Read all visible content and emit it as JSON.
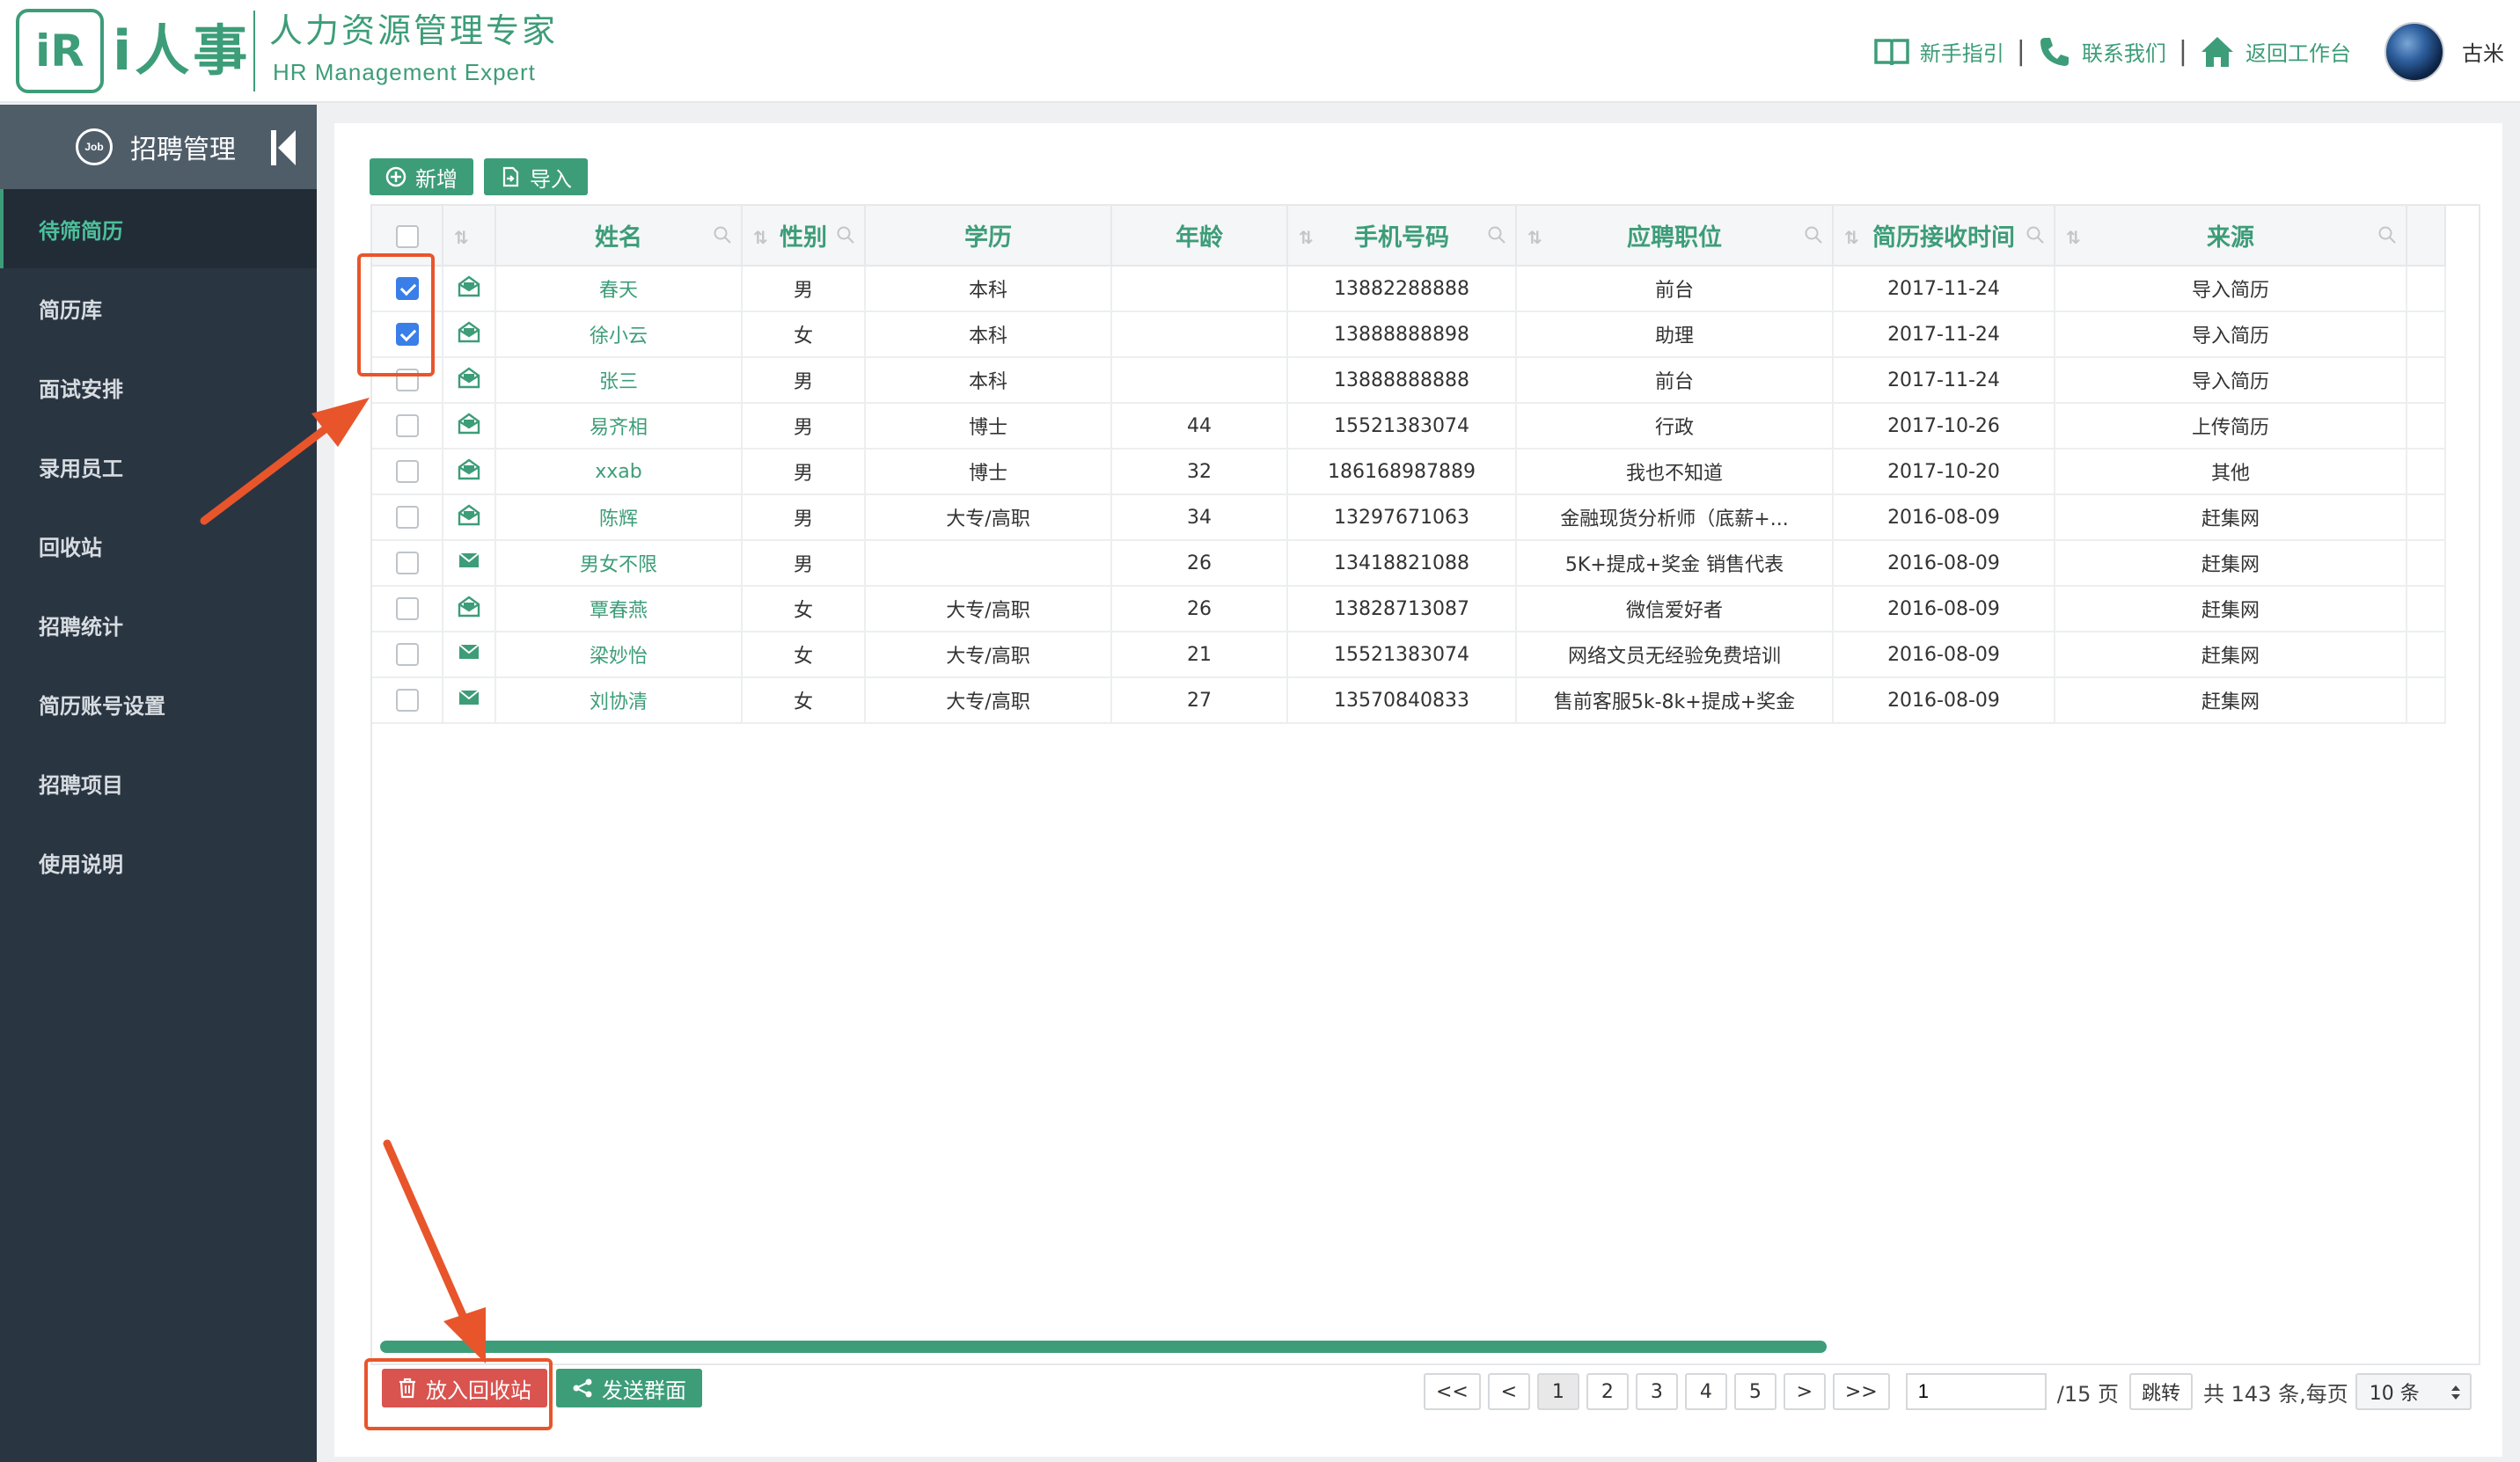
{
  "header": {
    "logo_mark": "iR",
    "logo_word": "i人事",
    "logo_cn": "人力资源管理专家",
    "logo_en": "HR Management Expert",
    "links": [
      "新手指引",
      "联系我们",
      "返回工作台"
    ],
    "username": "古米"
  },
  "sidebar": {
    "title": "招聘管理",
    "job_icon_text": "Job",
    "items": [
      "待筛简历",
      "简历库",
      "面试安排",
      "录用员工",
      "回收站",
      "招聘统计",
      "简历账号设置",
      "招聘项目",
      "使用说明"
    ],
    "active_index": 0
  },
  "toolbar": {
    "add_label": "新增",
    "import_label": "导入"
  },
  "table": {
    "columns": [
      "姓名",
      "性别",
      "学历",
      "年龄",
      "手机号码",
      "应聘职位",
      "简历接收时间",
      "来源"
    ],
    "rows": [
      {
        "checked": true,
        "icon": "mail-open-icon",
        "name": "春天",
        "gender": "男",
        "edu": "本科",
        "age": "",
        "phone": "13882288888",
        "position": "前台",
        "date": "2017-11-24",
        "source": "导入简历"
      },
      {
        "checked": true,
        "icon": "mail-open-icon",
        "name": "徐小云",
        "gender": "女",
        "edu": "本科",
        "age": "",
        "phone": "13888888898",
        "position": "助理",
        "date": "2017-11-24",
        "source": "导入简历"
      },
      {
        "checked": false,
        "icon": "mail-open-icon",
        "name": "张三",
        "gender": "男",
        "edu": "本科",
        "age": "",
        "phone": "13888888888",
        "position": "前台",
        "date": "2017-11-24",
        "source": "导入简历"
      },
      {
        "checked": false,
        "icon": "mail-open-icon",
        "name": "易齐相",
        "gender": "男",
        "edu": "博士",
        "age": "44",
        "phone": "15521383074",
        "position": "行政",
        "date": "2017-10-26",
        "source": "上传简历"
      },
      {
        "checked": false,
        "icon": "mail-open-icon",
        "name": "xxab",
        "gender": "男",
        "edu": "博士",
        "age": "32",
        "phone": "186168987889",
        "position": "我也不知道",
        "date": "2017-10-20",
        "source": "其他"
      },
      {
        "checked": false,
        "icon": "mail-open-icon",
        "name": "陈辉",
        "gender": "男",
        "edu": "大专/高职",
        "age": "34",
        "phone": "13297671063",
        "position": "金融现货分析师（底薪+...",
        "date": "2016-08-09",
        "source": "赶集网"
      },
      {
        "checked": false,
        "icon": "mail-icon",
        "name": "男女不限",
        "gender": "男",
        "edu": "",
        "age": "26",
        "phone": "13418821088",
        "position": "5K+提成+奖金 销售代表",
        "date": "2016-08-09",
        "source": "赶集网"
      },
      {
        "checked": false,
        "icon": "mail-open-icon",
        "name": "覃春燕",
        "gender": "女",
        "edu": "大专/高职",
        "age": "26",
        "phone": "13828713087",
        "position": "微信爱好者",
        "date": "2016-08-09",
        "source": "赶集网"
      },
      {
        "checked": false,
        "icon": "mail-icon",
        "name": "梁妙怡",
        "gender": "女",
        "edu": "大专/高职",
        "age": "21",
        "phone": "15521383074",
        "position": "网络文员无经验免费培训",
        "date": "2016-08-09",
        "source": "赶集网"
      },
      {
        "checked": false,
        "icon": "mail-icon",
        "name": "刘协清",
        "gender": "女",
        "edu": "大专/高职",
        "age": "27",
        "phone": "13570840833",
        "position": "售前客服5k-8k+提成+奖金",
        "date": "2016-08-09",
        "source": "赶集网"
      }
    ]
  },
  "footer": {
    "recycle_label": "放入回收站",
    "send_label": "发送群面"
  },
  "pagination": {
    "first": "<<",
    "prev": "<",
    "pages": [
      "1",
      "2",
      "3",
      "4",
      "5"
    ],
    "current": "1",
    "next": ">",
    "last": ">>",
    "jump_value": "1",
    "total_pages": "/15 页",
    "jump_label": "跳转",
    "summary": "共 143 条,每页",
    "page_size": "10 条"
  },
  "colors": {
    "brand": "#3d9d79",
    "sidebar": "#2a3542",
    "danger": "#d9534f",
    "annotation": "#e8552b",
    "checkbox": "#3a7ee8"
  }
}
